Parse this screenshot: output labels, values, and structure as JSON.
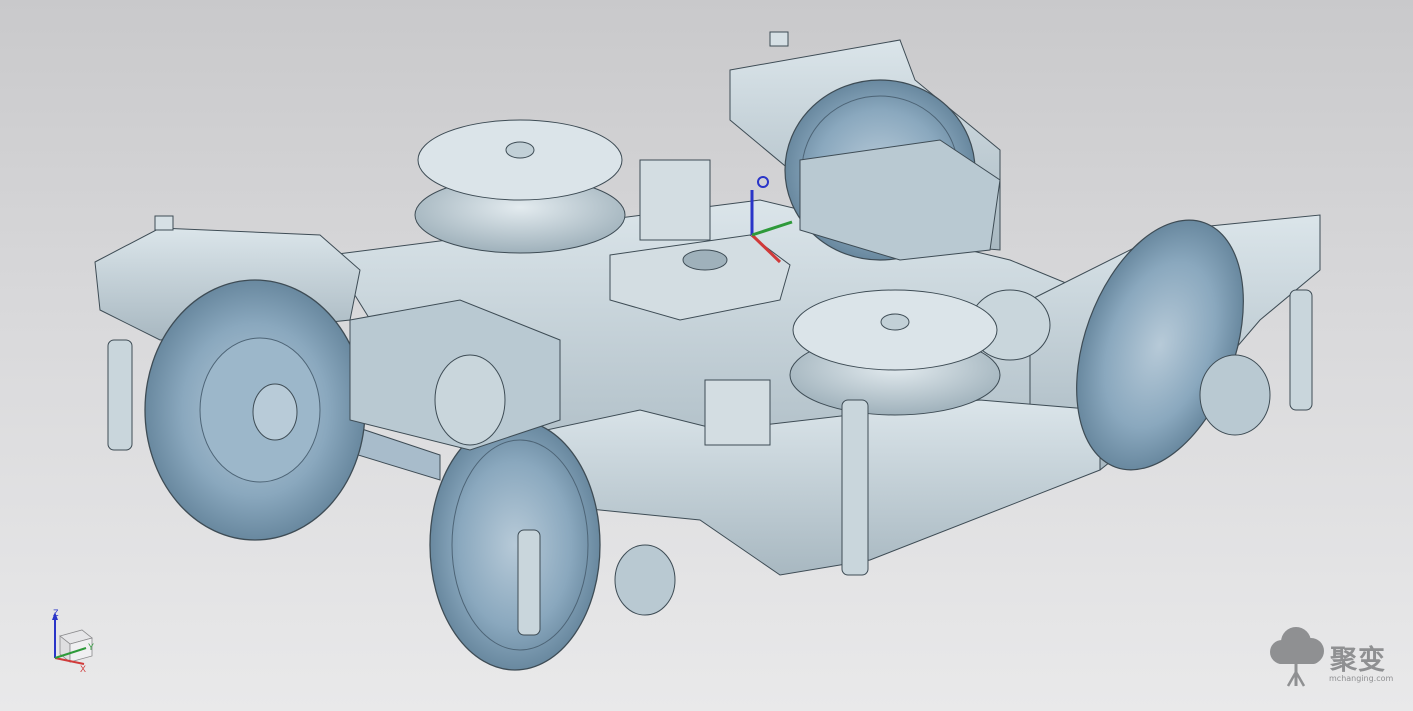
{
  "viewport": {
    "background_top": "#c9c9cb",
    "background_bottom": "#e9e9ea",
    "model_color_body": "#c9d6dc",
    "model_color_wheel": "#7f9fb6",
    "model_color_edge": "#3e4c55"
  },
  "triad": {
    "z_label": "Z",
    "y_label": "Y",
    "x_label": "X",
    "x_color": "#d03a3a",
    "y_color": "#2e9a3a",
    "z_color": "#2a35c8"
  },
  "watermark": {
    "logo_icon": "tree-cloud-icon",
    "text_cn": "聚变",
    "url": "mchanging.com"
  }
}
